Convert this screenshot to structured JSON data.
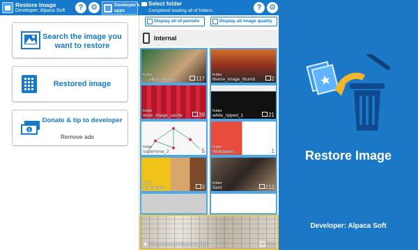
{
  "left": {
    "app_title": "Restore Image",
    "developer_line": "Developer: Alpaca Soft",
    "help_glyph": "?",
    "settings_glyph": "⚙",
    "developer_apps": "Developer's apps",
    "menu": {
      "search": "Search the image you want to restore",
      "restored": "Restored image",
      "donate": "Donate & tip to developer",
      "donate_sub": "Remove ads"
    }
  },
  "middle": {
    "title": "Select folder",
    "subtitle": "Completed reading all of folders.",
    "btn_periods": "Display all of periods",
    "btn_quality": "Display all image quality",
    "storage_label": "Internal",
    "folder_word": "folder",
    "folders": [
      {
        "name": "albumthumbs",
        "count": "117"
      },
      {
        "name": "theme_image_thumb",
        "count": "2"
      },
      {
        "name": "store_image_cache",
        "count": "39"
      },
      {
        "name": "white_ripped_1",
        "count": "21"
      },
      {
        "name": "supernova_2",
        "count": "5"
      },
      {
        "name": "Wallpapers",
        "count": "1"
      },
      {
        "name": "thumbnails",
        "count": "3"
      },
      {
        "name": "Sent",
        "count": "212"
      }
    ],
    "recommend": {
      "label": "Recommend (high quality)",
      "count": "212"
    }
  },
  "right": {
    "title": "Restore Image",
    "developer": "Developer: Alpaca Soft"
  },
  "colors": {
    "brand_blue": "#1679c9",
    "accent_yellow": "#f3b62b"
  }
}
